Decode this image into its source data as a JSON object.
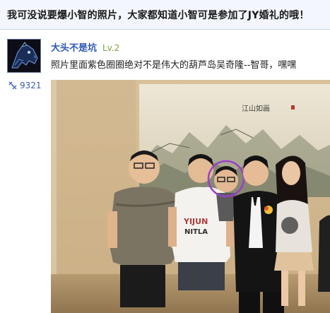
{
  "thread": {
    "title": "我可没说要爆小智的照片，大家都知道小智可是参加了JY婚礼的哦！"
  },
  "post": {
    "author": {
      "name": "大头不是坑",
      "level": "Lv.2",
      "avatar_icon": "dark-wolf-avatar",
      "fans_icon": "fans-icon",
      "fans_count": "9321"
    },
    "text": "照片里面紫色圈圈绝对不是伟大的葫芦岛吴奇隆--智哥，嘿嘿",
    "photo": {
      "shirt_text_line1": "YIJUN",
      "shirt_text_line2": "NITLA",
      "painting_caption": "江山如画",
      "highlight_color": "#9b3fc9"
    }
  },
  "colors": {
    "title_bar_bg": "#f3f7fd",
    "username": "#2b57b3",
    "level": "#7aa23d",
    "fans": "#3a5ea8"
  }
}
